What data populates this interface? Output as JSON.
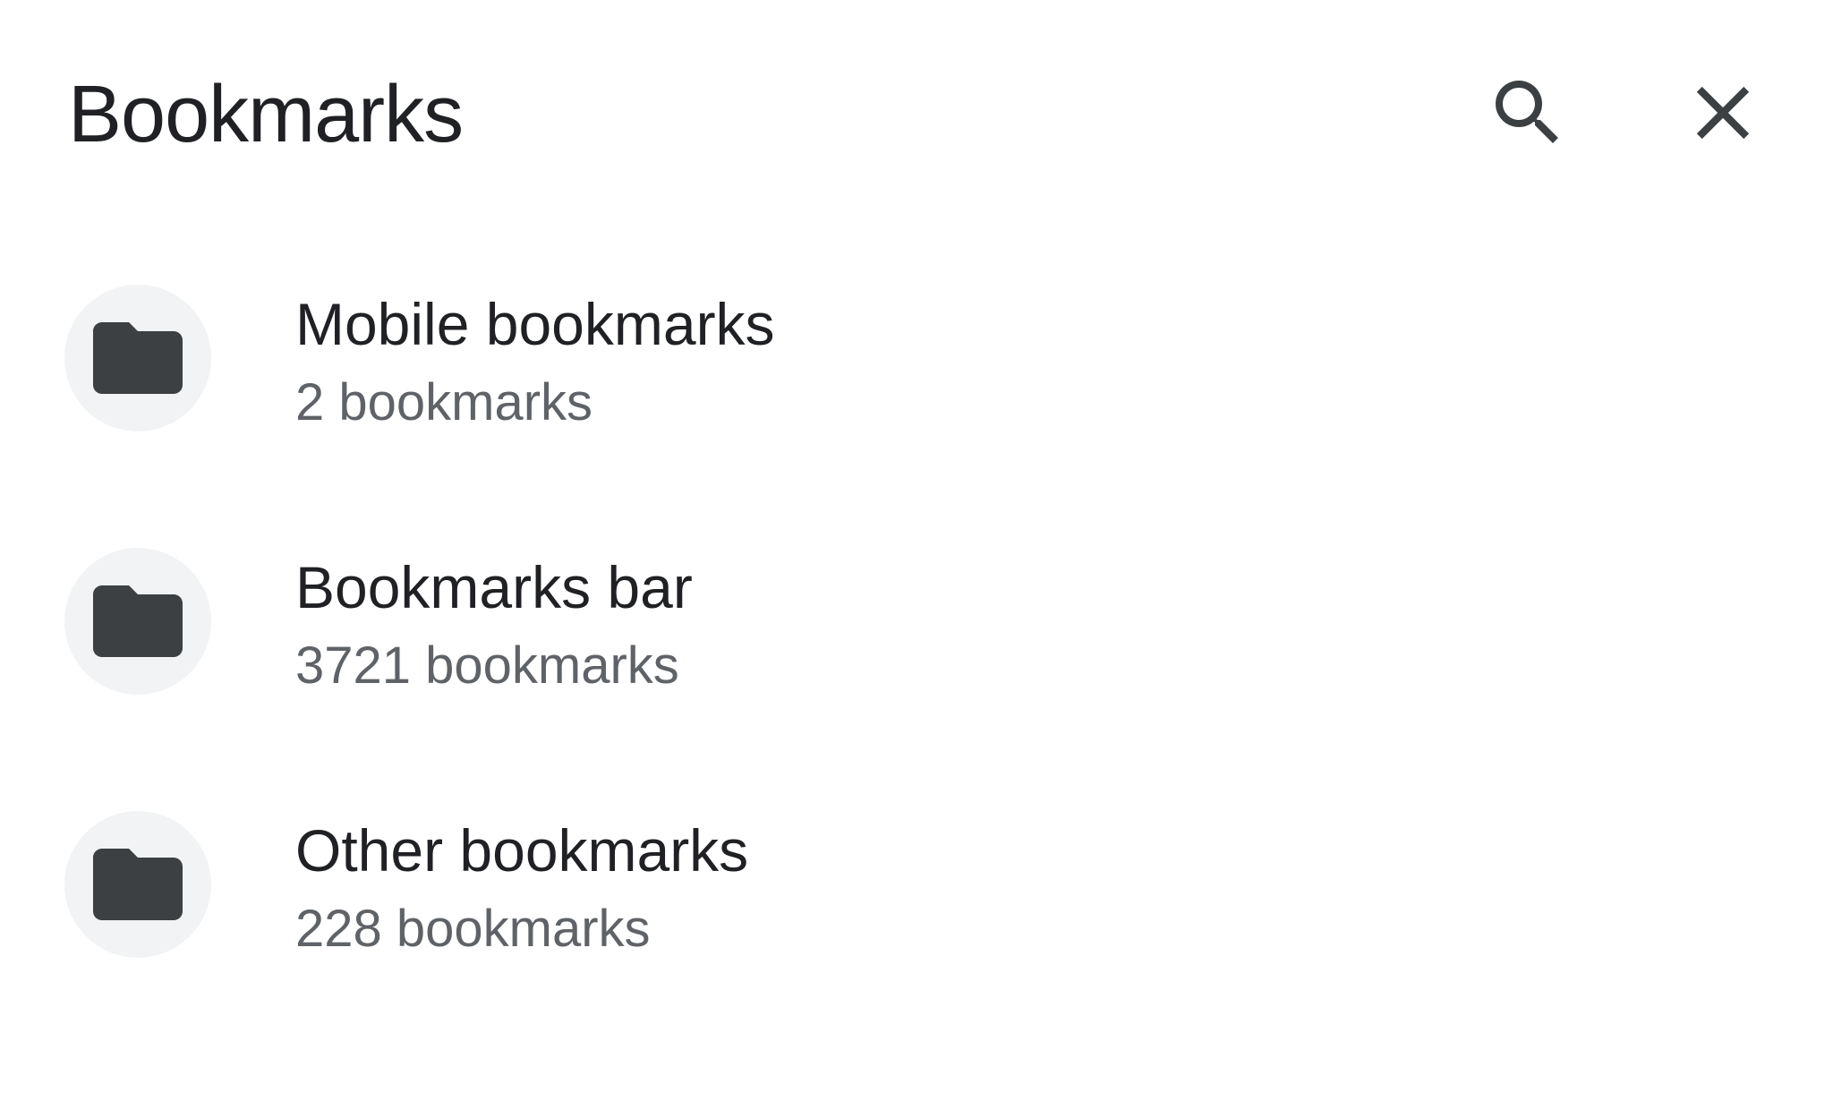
{
  "header": {
    "title": "Bookmarks",
    "actions": [
      {
        "icon": "search-icon",
        "label": "Search"
      },
      {
        "icon": "close-icon",
        "label": "Close"
      }
    ]
  },
  "folders": [
    {
      "icon": "folder-icon",
      "name": "Mobile bookmarks",
      "count": "2 bookmarks"
    },
    {
      "icon": "folder-icon",
      "name": "Bookmarks bar",
      "count": "3721 bookmarks"
    },
    {
      "icon": "folder-icon",
      "name": "Other bookmarks",
      "count": "228 bookmarks"
    }
  ],
  "colors": {
    "text_primary": "#202124",
    "text_secondary": "#5f6368",
    "icon": "#3c4043",
    "avatar_bg": "#f1f3f4",
    "background": "#ffffff"
  }
}
